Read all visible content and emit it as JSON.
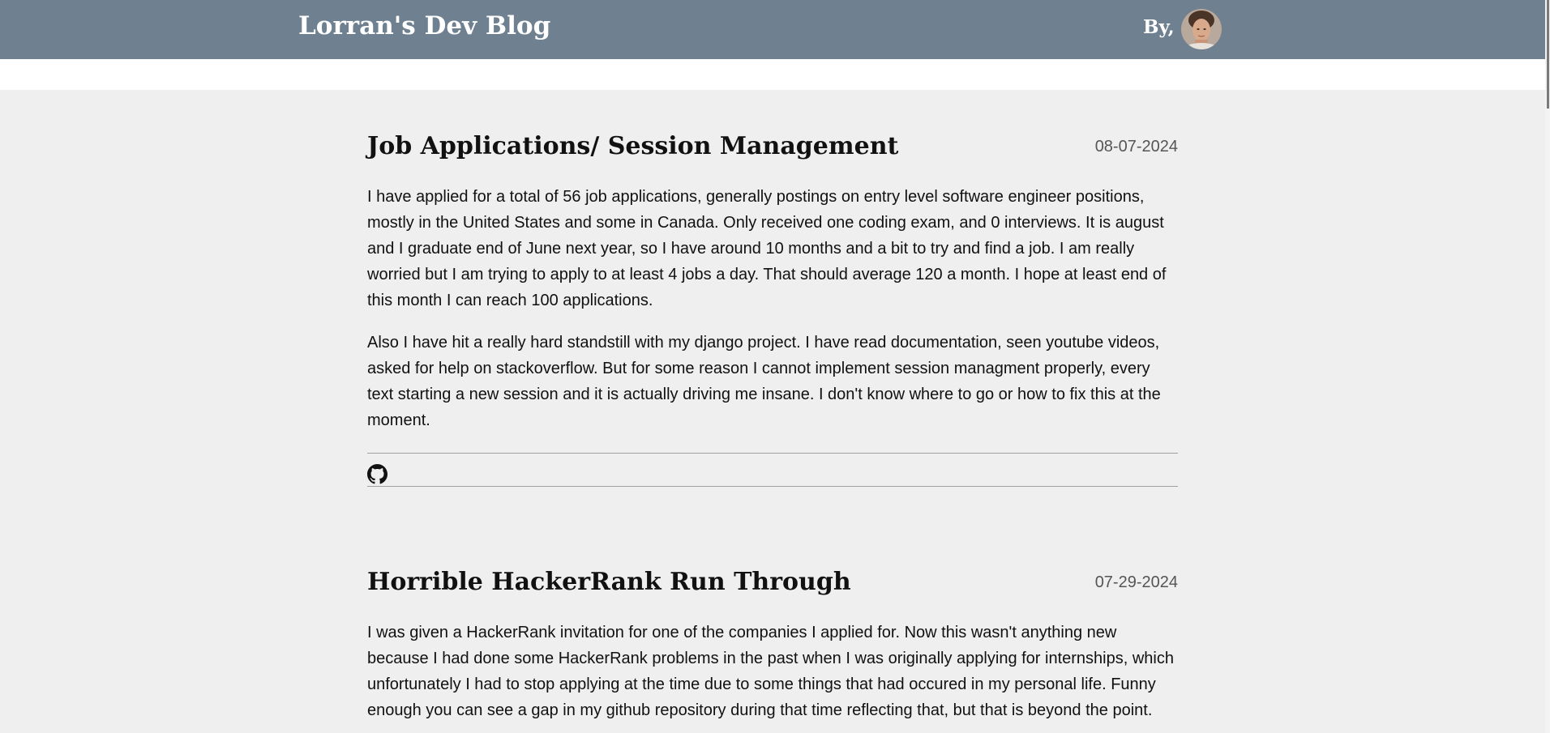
{
  "header": {
    "title": "Lorran's Dev Blog",
    "byline": "By,",
    "background": "#6f8090"
  },
  "posts": [
    {
      "title": "Job Applications/ Session Management",
      "date": "08-07-2024",
      "paragraphs": [
        "I have applied for a total of 56 job applications, generally postings on entry level software engineer positions, mostly in the United States and some in Canada. Only received one coding exam, and 0 interviews. It is august and I graduate end of June next year, so I have around 10 months and a bit to try and find a job. I am really worried but I am trying to apply to at least 4 jobs a day. That should average 120 a month. I hope at least end of this month I can reach 100 applications.",
        "Also I have hit a really hard standstill with my django project. I have read documentation, seen youtube videos, asked for help on stackoverflow. But for some reason I cannot implement session managment properly, every text starting a new session and it is actually driving me insane. I don't know where to go or how to fix this at the moment."
      ],
      "icon": "github-icon"
    },
    {
      "title": "Horrible HackerRank Run Through",
      "date": "07-29-2024",
      "paragraphs": [
        "I was given a HackerRank invitation for one of the companies I applied for. Now this wasn't anything new because I had done some HackerRank problems in the past when I was originally applying for internships, which unfortunately I had to stop applying at the time due to some things that had occured in my personal life. Funny enough you can see a gap in my github repository during that time reflecting that, but that is beyond the point."
      ]
    }
  ]
}
